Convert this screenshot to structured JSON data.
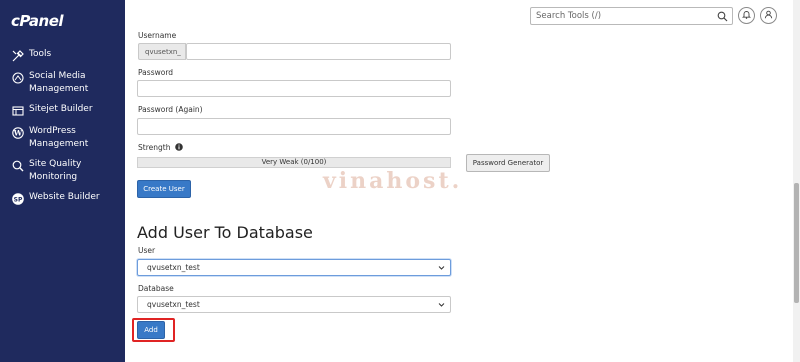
{
  "sidebar": {
    "logo": "cPanel",
    "items": [
      {
        "label": "Tools",
        "icon": "tools-icon"
      },
      {
        "label": "Social Media Management",
        "icon": "social-media-icon"
      },
      {
        "label": "Sitejet Builder",
        "icon": "sitejet-icon"
      },
      {
        "label": "WordPress Management",
        "icon": "wordpress-icon"
      },
      {
        "label": "Site Quality Monitoring",
        "icon": "site-quality-icon"
      },
      {
        "label": "Website Builder",
        "icon": "website-builder-icon"
      }
    ]
  },
  "topbar": {
    "search_placeholder": "Search Tools (/)",
    "icons": [
      "search-icon",
      "bell-icon",
      "user-icon"
    ]
  },
  "form": {
    "username_label": "Username",
    "username_prefix": "qvusetxn_",
    "username_value": "",
    "password_label": "Password",
    "password_value": "",
    "password_again_label": "Password (Again)",
    "password_again_value": "",
    "strength_label": "Strength",
    "strength_value": "Very Weak (0/100)",
    "password_generator_label": "Password Generator",
    "create_user_label": "Create User"
  },
  "add_user_to_db": {
    "title": "Add User To Database",
    "user_label": "User",
    "user_selected": "qvusetxn_test",
    "database_label": "Database",
    "database_selected": "qvusetxn_test",
    "add_label": "Add"
  },
  "watermark": "vinahost.",
  "colors": {
    "sidebar_bg": "#1f2a5e",
    "primary": "#3879c7",
    "highlight": "#e02424"
  }
}
